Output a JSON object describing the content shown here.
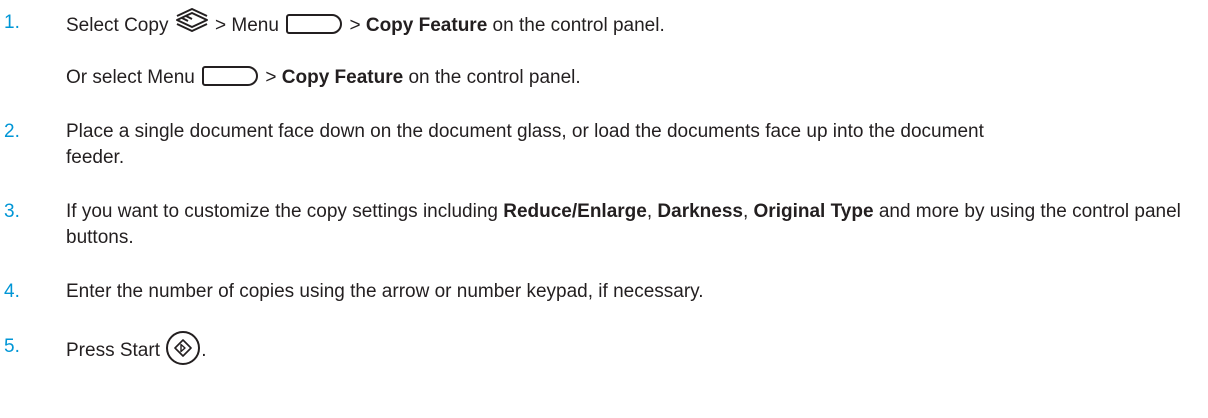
{
  "steps": [
    {
      "number": "1.",
      "parts": {
        "a": "Select Copy",
        "b": " > Menu",
        "c": " > ",
        "d": "Copy Feature",
        "e": " on the control panel."
      },
      "icons": [
        "copy-icon",
        "menu-button-icon"
      ]
    },
    {
      "number": "",
      "parts": {
        "a": "Or select Menu",
        "b": " > ",
        "c": "Copy Feature",
        "d": " on the control panel."
      },
      "icons": [
        "menu-button-icon"
      ]
    },
    {
      "number": "2.",
      "parts": {
        "a": "Place a single document face down on the document glass, or load the documents face up into the document feeder."
      }
    },
    {
      "number": "3.",
      "parts": {
        "a": "If you want to customize the copy settings including ",
        "b": "Reduce/Enlarge",
        "c": ", ",
        "d": "Darkness",
        "e": ", ",
        "f": "Original Type",
        "g": " and more by using the control panel buttons."
      }
    },
    {
      "number": "4.",
      "parts": {
        "a": "Enter the number of copies using the arrow or number keypad, if necessary."
      }
    },
    {
      "number": "5.",
      "parts": {
        "a": "Press Start",
        "b": "."
      },
      "icons": [
        "start-button-icon"
      ]
    }
  ],
  "colors": {
    "step_number": "#0096d6",
    "text": "#231f20",
    "background": "#ffffff"
  }
}
